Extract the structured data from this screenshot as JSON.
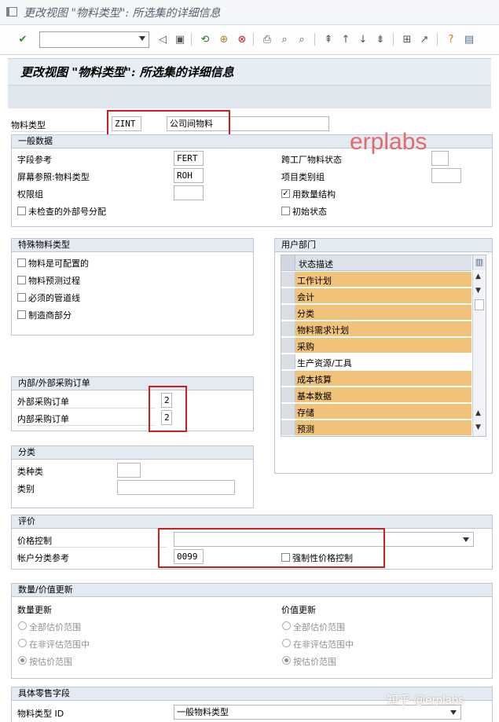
{
  "window_title": "更改视图 \"物料类型\": 所选集的详细信息",
  "screen_title": "更改视图 \"物料类型\": 所选集的详细信息",
  "toolbar": {
    "command_value": "",
    "icons": [
      "enter-check-icon",
      "back-icon",
      "save-icon",
      "back-green-icon",
      "exit-icon",
      "cancel-icon",
      "print-icon",
      "find-icon",
      "find-next-icon",
      "first-page-icon",
      "prev-page-icon",
      "next-page-icon",
      "last-page-icon",
      "create-session-icon",
      "shortcut-icon",
      "help-icon",
      "customize-layout-icon"
    ]
  },
  "material_type": {
    "label": "物料类型",
    "code": "ZINT",
    "description": "公司间物料"
  },
  "general": {
    "title": "一般数据",
    "field_ref_label": "字段参考",
    "field_ref_value": "FERT",
    "screen_ref_label": "屏幕参照:物料类型",
    "screen_ref_value": "ROH",
    "auth_group_label": "权限组",
    "auth_group_value": "",
    "ext_numbering_label": "未检查的外部号分配",
    "ext_numbering_checked": false,
    "cross_plant_label": "跨工厂物料状态",
    "cross_plant_value": "",
    "item_cat_label": "项目类别组",
    "item_cat_value": "",
    "qty_structure_label": "用数量结构",
    "qty_structure_checked": true,
    "initial_status_label": "初始状态",
    "initial_status_checked": false
  },
  "watermark": "erplabs",
  "special": {
    "title": "特殊物料类型",
    "items": [
      {
        "label": "物料是可配置的",
        "checked": false
      },
      {
        "label": "物料预测过程",
        "checked": false
      },
      {
        "label": "必须的管道线",
        "checked": false
      },
      {
        "label": "制造商部分",
        "checked": false
      }
    ]
  },
  "user_dept": {
    "title": "用户部门",
    "column_header": "状态描述",
    "rows": [
      {
        "label": "工作计划",
        "highlight": true
      },
      {
        "label": "会计",
        "highlight": true
      },
      {
        "label": "分类",
        "highlight": true
      },
      {
        "label": "物料需求计划",
        "highlight": true
      },
      {
        "label": "采购",
        "highlight": true
      },
      {
        "label": "生产资源/工具",
        "highlight": false
      },
      {
        "label": "成本核算",
        "highlight": true
      },
      {
        "label": "基本数据",
        "highlight": true
      },
      {
        "label": "存储",
        "highlight": true
      },
      {
        "label": "预测",
        "highlight": true
      }
    ]
  },
  "purchase": {
    "title": "内部/外部采购订单",
    "external_label": "外部采购订单",
    "external_value": "2",
    "internal_label": "内部采购订单",
    "internal_value": "2"
  },
  "classification": {
    "title": "分类",
    "class_type_label": "类种类",
    "class_type_value": "",
    "class_label": "类别",
    "class_value": ""
  },
  "valuation": {
    "title": "评价",
    "price_control_label": "价格控制",
    "price_control_value": "",
    "acct_cat_label": "帐户分类参考",
    "acct_cat_value": "0099",
    "force_price_label": "强制性价格控制",
    "force_price_checked": false
  },
  "update": {
    "title": "数量/价值更新",
    "qty_heading": "数量更新",
    "value_heading": "价值更新",
    "options": [
      "全部估价范围",
      "在非评估范围中",
      "按估价范围"
    ],
    "qty_selected": 2,
    "value_selected": 2
  },
  "retail": {
    "title": "具体零售字段",
    "mat_type_id_label": "物料类型 ID",
    "mat_type_id_value": "一般物料类型"
  },
  "footer_watermark": "知乎 @erplabs"
}
